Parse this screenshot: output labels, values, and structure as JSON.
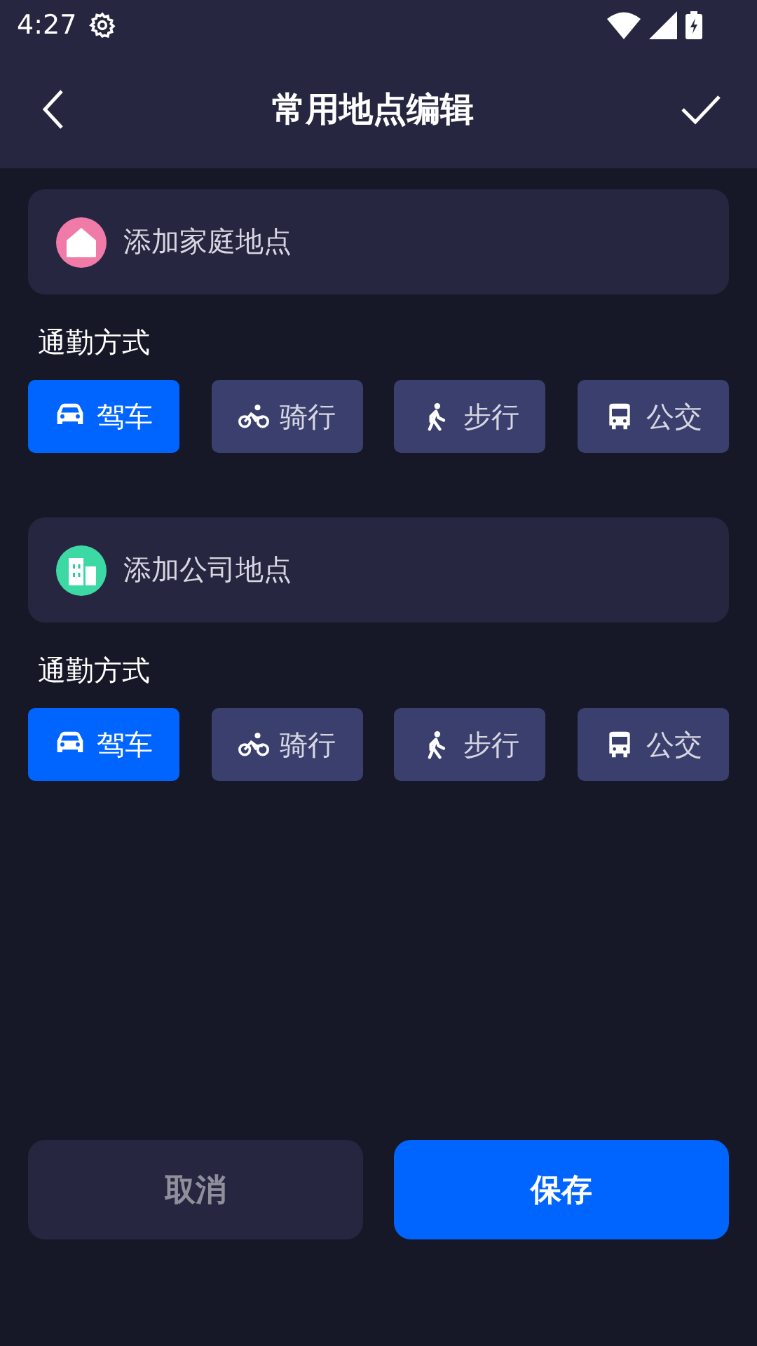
{
  "status_bar": {
    "time": "4:27"
  },
  "header": {
    "title": "常用地点编辑"
  },
  "places": [
    {
      "kind": "home",
      "label": "添加家庭地点",
      "mode_label": "通勤方式",
      "modes": [
        {
          "kind": "car",
          "label": "驾车",
          "selected": true
        },
        {
          "kind": "bike",
          "label": "骑行",
          "selected": false
        },
        {
          "kind": "walk",
          "label": "步行",
          "selected": false
        },
        {
          "kind": "bus",
          "label": "公交",
          "selected": false
        }
      ]
    },
    {
      "kind": "company",
      "label": "添加公司地点",
      "mode_label": "通勤方式",
      "modes": [
        {
          "kind": "car",
          "label": "驾车",
          "selected": true
        },
        {
          "kind": "bike",
          "label": "骑行",
          "selected": false
        },
        {
          "kind": "walk",
          "label": "步行",
          "selected": false
        },
        {
          "kind": "bus",
          "label": "公交",
          "selected": false
        }
      ]
    }
  ],
  "buttons": {
    "cancel": "取消",
    "save": "保存"
  }
}
